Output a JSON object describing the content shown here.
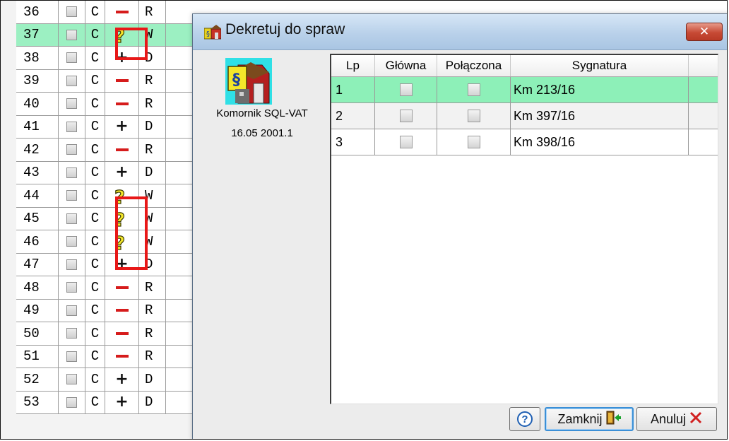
{
  "background_list": {
    "rows": [
      {
        "num": "36",
        "c": "C",
        "op": "minus",
        "letter": "R"
      },
      {
        "num": "37",
        "c": "C",
        "op": "question",
        "letter": "W",
        "highlighted": true
      },
      {
        "num": "38",
        "c": "C",
        "op": "plus",
        "letter": "D"
      },
      {
        "num": "39",
        "c": "C",
        "op": "minus",
        "letter": "R"
      },
      {
        "num": "40",
        "c": "C",
        "op": "minus",
        "letter": "R"
      },
      {
        "num": "41",
        "c": "C",
        "op": "plus",
        "letter": "D"
      },
      {
        "num": "42",
        "c": "C",
        "op": "minus",
        "letter": "R"
      },
      {
        "num": "43",
        "c": "C",
        "op": "plus",
        "letter": "D"
      },
      {
        "num": "44",
        "c": "C",
        "op": "question",
        "letter": "W"
      },
      {
        "num": "45",
        "c": "C",
        "op": "question",
        "letter": "W"
      },
      {
        "num": "46",
        "c": "C",
        "op": "question",
        "letter": "W"
      },
      {
        "num": "47",
        "c": "C",
        "op": "plus",
        "letter": "D"
      },
      {
        "num": "48",
        "c": "C",
        "op": "minus",
        "letter": "R"
      },
      {
        "num": "49",
        "c": "C",
        "op": "minus",
        "letter": "R"
      },
      {
        "num": "50",
        "c": "C",
        "op": "minus",
        "letter": "R"
      },
      {
        "num": "51",
        "c": "C",
        "op": "minus",
        "letter": "R"
      },
      {
        "num": "52",
        "c": "C",
        "op": "plus",
        "letter": "D"
      },
      {
        "num": "53",
        "c": "C",
        "op": "plus",
        "letter": "D"
      }
    ]
  },
  "dialog": {
    "title": "Dekretuj do spraw",
    "close_symbol": "✕",
    "app_name": "Komornik SQL-VAT",
    "app_version": "16.05 2001.1",
    "table": {
      "columns": [
        "Lp",
        "Główna",
        "Połączona",
        "Sygnatura"
      ],
      "rows": [
        {
          "lp": "1",
          "glowna": false,
          "polaczona": false,
          "sygnatura": "Km 213/16",
          "selected": true
        },
        {
          "lp": "2",
          "glowna": false,
          "polaczona": false,
          "sygnatura": "Km 397/16"
        },
        {
          "lp": "3",
          "glowna": false,
          "polaczona": false,
          "sygnatura": "Km 398/16"
        }
      ]
    },
    "buttons": {
      "help_symbol": "?",
      "close_label": "Zamknij",
      "cancel_label": "Anuluj"
    }
  },
  "colors": {
    "highlight_row": "#9cf0c2",
    "selected_row": "#8df0b8",
    "minus": "#d61c1c",
    "annotation_box": "#e81818",
    "question_icon": "#f2e52b"
  }
}
